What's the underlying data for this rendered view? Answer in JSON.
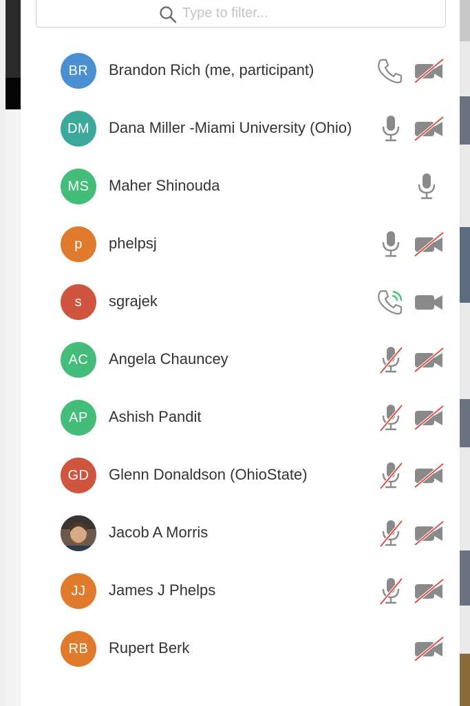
{
  "search": {
    "placeholder": "Type to filter..."
  },
  "colors": {
    "icon_gray": "#8a8a8a",
    "strike_red": "#e0433b",
    "call_green": "#34c65a",
    "avatar_blue": "#4a8fd1",
    "avatar_teal": "#3aa89a",
    "avatar_green": "#45bd7a",
    "avatar_orange": "#e07a2c",
    "avatar_red": "#d0553f"
  },
  "participants": [
    {
      "initials": "BR",
      "name": "Brandon Rich (me, participant)",
      "avatar_color": "#4a8fd1",
      "audio": "phone",
      "video": "off"
    },
    {
      "initials": "DM",
      "name": "Dana Miller -Miami University (Ohio)",
      "avatar_color": "#3aa89a",
      "audio": "mic-on",
      "video": "off"
    },
    {
      "initials": "MS",
      "name": "Maher Shinouda",
      "avatar_color": "#45bd7a",
      "audio": "none",
      "video": "none",
      "right_icon": "mic-on"
    },
    {
      "initials": "p",
      "name": "phelpsj",
      "avatar_color": "#e07a2c",
      "audio": "mic-on",
      "video": "off"
    },
    {
      "initials": "s",
      "name": "sgrajek",
      "avatar_color": "#d0553f",
      "audio": "phone-active",
      "video": "on"
    },
    {
      "initials": "AC",
      "name": "Angela Chauncey",
      "avatar_color": "#45bd7a",
      "audio": "mic-off",
      "video": "off"
    },
    {
      "initials": "AP",
      "name": "Ashish Pandit",
      "avatar_color": "#45bd7a",
      "audio": "mic-off",
      "video": "off"
    },
    {
      "initials": "GD",
      "name": "Glenn Donaldson (OhioState)",
      "avatar_color": "#d0553f",
      "audio": "mic-off",
      "video": "off"
    },
    {
      "initials": "",
      "name": "Jacob A Morris",
      "avatar_color": "#5a4a3e",
      "avatar_photo": true,
      "audio": "mic-off",
      "video": "off"
    },
    {
      "initials": "JJ",
      "name": "James J Phelps",
      "avatar_color": "#e07a2c",
      "audio": "mic-off",
      "video": "off"
    },
    {
      "initials": "RB",
      "name": "Rupert Berk",
      "avatar_color": "#e07a2c",
      "audio": "none",
      "video": "off"
    }
  ]
}
